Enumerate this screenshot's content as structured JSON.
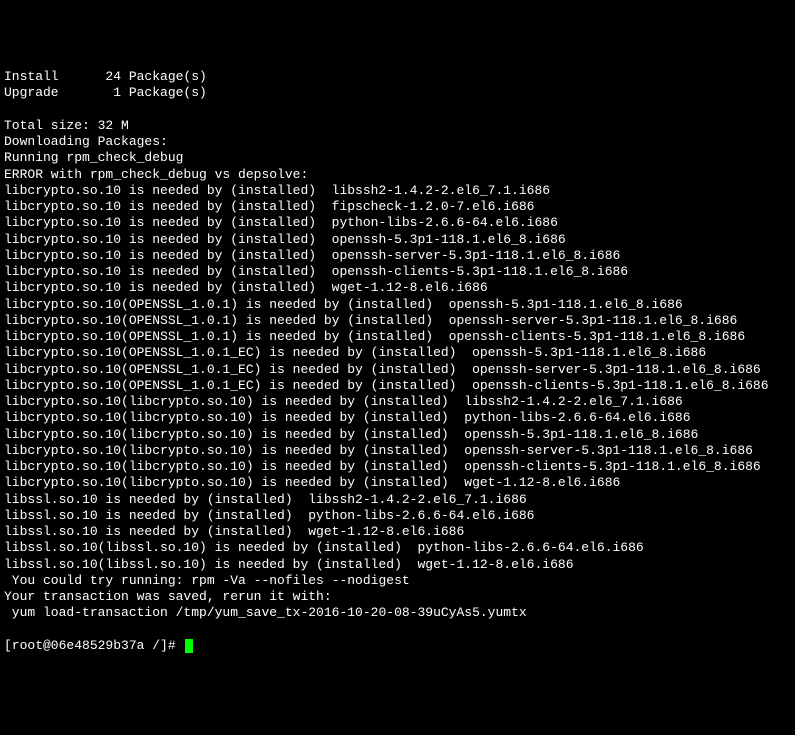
{
  "lines": [
    "Install      24 Package(s)",
    "Upgrade       1 Package(s)",
    "",
    "Total size: 32 M",
    "Downloading Packages:",
    "Running rpm_check_debug",
    "ERROR with rpm_check_debug vs depsolve:",
    "libcrypto.so.10 is needed by (installed)  libssh2-1.4.2-2.el6_7.1.i686",
    "libcrypto.so.10 is needed by (installed)  fipscheck-1.2.0-7.el6.i686",
    "libcrypto.so.10 is needed by (installed)  python-libs-2.6.6-64.el6.i686",
    "libcrypto.so.10 is needed by (installed)  openssh-5.3p1-118.1.el6_8.i686",
    "libcrypto.so.10 is needed by (installed)  openssh-server-5.3p1-118.1.el6_8.i686",
    "libcrypto.so.10 is needed by (installed)  openssh-clients-5.3p1-118.1.el6_8.i686",
    "libcrypto.so.10 is needed by (installed)  wget-1.12-8.el6.i686",
    "libcrypto.so.10(OPENSSL_1.0.1) is needed by (installed)  openssh-5.3p1-118.1.el6_8.i686",
    "libcrypto.so.10(OPENSSL_1.0.1) is needed by (installed)  openssh-server-5.3p1-118.1.el6_8.i686",
    "libcrypto.so.10(OPENSSL_1.0.1) is needed by (installed)  openssh-clients-5.3p1-118.1.el6_8.i686",
    "libcrypto.so.10(OPENSSL_1.0.1_EC) is needed by (installed)  openssh-5.3p1-118.1.el6_8.i686",
    "libcrypto.so.10(OPENSSL_1.0.1_EC) is needed by (installed)  openssh-server-5.3p1-118.1.el6_8.i686",
    "libcrypto.so.10(OPENSSL_1.0.1_EC) is needed by (installed)  openssh-clients-5.3p1-118.1.el6_8.i686",
    "libcrypto.so.10(libcrypto.so.10) is needed by (installed)  libssh2-1.4.2-2.el6_7.1.i686",
    "libcrypto.so.10(libcrypto.so.10) is needed by (installed)  python-libs-2.6.6-64.el6.i686",
    "libcrypto.so.10(libcrypto.so.10) is needed by (installed)  openssh-5.3p1-118.1.el6_8.i686",
    "libcrypto.so.10(libcrypto.so.10) is needed by (installed)  openssh-server-5.3p1-118.1.el6_8.i686",
    "libcrypto.so.10(libcrypto.so.10) is needed by (installed)  openssh-clients-5.3p1-118.1.el6_8.i686",
    "libcrypto.so.10(libcrypto.so.10) is needed by (installed)  wget-1.12-8.el6.i686",
    "libssl.so.10 is needed by (installed)  libssh2-1.4.2-2.el6_7.1.i686",
    "libssl.so.10 is needed by (installed)  python-libs-2.6.6-64.el6.i686",
    "libssl.so.10 is needed by (installed)  wget-1.12-8.el6.i686",
    "libssl.so.10(libssl.so.10) is needed by (installed)  python-libs-2.6.6-64.el6.i686",
    "libssl.so.10(libssl.so.10) is needed by (installed)  wget-1.12-8.el6.i686",
    " You could try running: rpm -Va --nofiles --nodigest",
    "Your transaction was saved, rerun it with:",
    " yum load-transaction /tmp/yum_save_tx-2016-10-20-08-39uCyAs5.yumtx"
  ],
  "prompt": "[root@06e48529b37a /]# "
}
